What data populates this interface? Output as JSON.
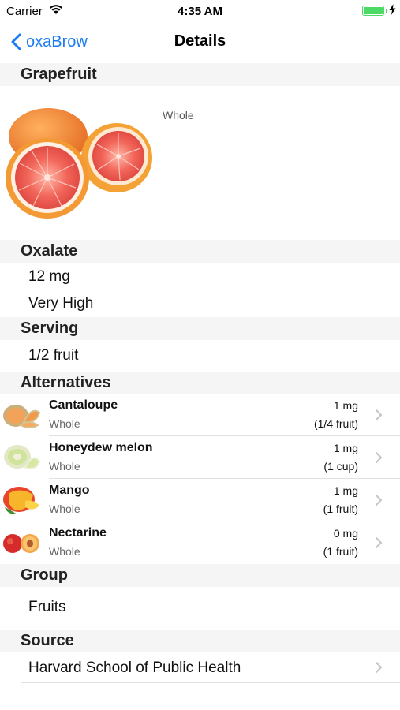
{
  "status": {
    "carrier": "Carrier",
    "time": "4:35 AM",
    "battery_level": 1.0
  },
  "nav": {
    "back_label": "oxaBrow",
    "title": "Details"
  },
  "food": {
    "name": "Grapefruit",
    "image_icon": "grapefruit-image",
    "image_caption": "Whole"
  },
  "oxalate": {
    "header": "Oxalate",
    "amount": "12 mg",
    "level": "Very High"
  },
  "serving": {
    "header": "Serving",
    "value": "1/2 fruit"
  },
  "alternatives": {
    "header": "Alternatives",
    "items": [
      {
        "name": "Cantaloupe",
        "form": "Whole",
        "amount": "1 mg",
        "serving": "(1/4 fruit)",
        "icon": "cantaloupe-icon"
      },
      {
        "name": "Honeydew melon",
        "form": "Whole",
        "amount": "1 mg",
        "serving": "(1 cup)",
        "icon": "honeydew-icon"
      },
      {
        "name": "Mango",
        "form": "Whole",
        "amount": "1 mg",
        "serving": "(1 fruit)",
        "icon": "mango-icon"
      },
      {
        "name": "Nectarine",
        "form": "Whole",
        "amount": "0 mg",
        "serving": "(1 fruit)",
        "icon": "nectarine-icon"
      }
    ]
  },
  "group": {
    "header": "Group",
    "value": "Fruits"
  },
  "source": {
    "header": "Source",
    "value": "Harvard School of Public Health"
  },
  "colors": {
    "accent": "#1a7cf3",
    "battery": "#4cd964",
    "section_bg": "#f5f5f5"
  }
}
